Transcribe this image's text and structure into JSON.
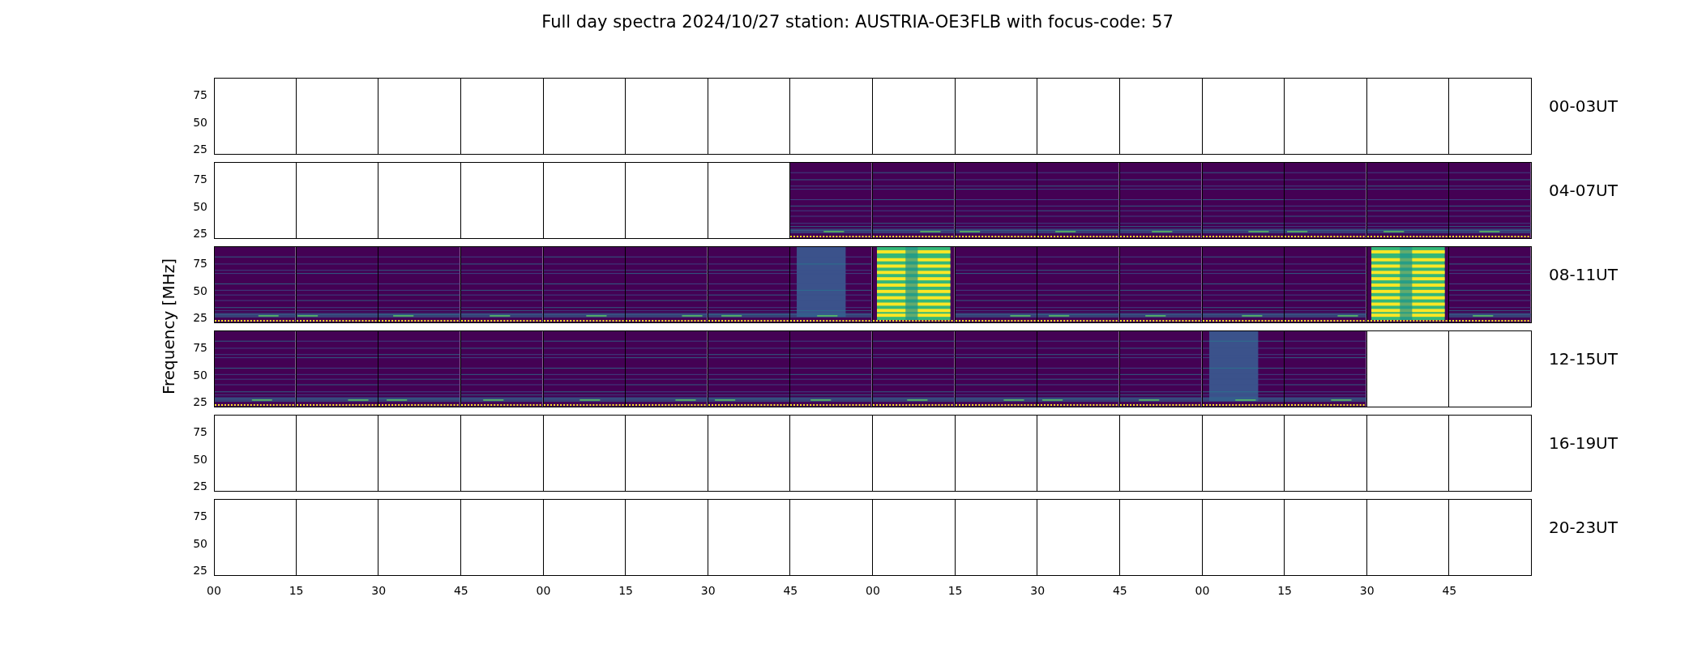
{
  "title": "Full day spectra 2024/10/27 station: AUSTRIA-OE3FLB with focus-code: 57",
  "ylabel": "Frequency [MHz]",
  "xticks": [
    "00",
    "15",
    "30",
    "45",
    "00",
    "15",
    "30",
    "45",
    "00",
    "15",
    "30",
    "45",
    "00",
    "15",
    "30",
    "45"
  ],
  "rows": [
    {
      "label": "00-03UT",
      "yticks": [
        "75",
        "50",
        "25"
      ],
      "panels": [
        {
          "kind": "empty"
        },
        {
          "kind": "empty"
        },
        {
          "kind": "empty"
        },
        {
          "kind": "empty"
        },
        {
          "kind": "empty"
        },
        {
          "kind": "empty"
        },
        {
          "kind": "empty"
        },
        {
          "kind": "empty"
        },
        {
          "kind": "empty"
        },
        {
          "kind": "empty"
        },
        {
          "kind": "empty"
        },
        {
          "kind": "empty"
        },
        {
          "kind": "empty"
        },
        {
          "kind": "empty"
        },
        {
          "kind": "empty"
        },
        {
          "kind": "empty"
        }
      ]
    },
    {
      "label": "04-07UT",
      "yticks": [
        "75",
        "50",
        "25"
      ],
      "panels": [
        {
          "kind": "empty"
        },
        {
          "kind": "empty"
        },
        {
          "kind": "empty"
        },
        {
          "kind": "empty"
        },
        {
          "kind": "empty"
        },
        {
          "kind": "empty"
        },
        {
          "kind": "empty"
        },
        {
          "kind": "spectrum"
        },
        {
          "kind": "spectrum"
        },
        {
          "kind": "spectrum"
        },
        {
          "kind": "spectrum"
        },
        {
          "kind": "spectrum"
        },
        {
          "kind": "spectrum"
        },
        {
          "kind": "spectrum"
        },
        {
          "kind": "spectrum"
        },
        {
          "kind": "spectrum"
        }
      ]
    },
    {
      "label": "08-11UT",
      "yticks": [
        "75",
        "50",
        "25"
      ],
      "panels": [
        {
          "kind": "spectrum"
        },
        {
          "kind": "spectrum"
        },
        {
          "kind": "spectrum"
        },
        {
          "kind": "spectrum"
        },
        {
          "kind": "spectrum"
        },
        {
          "kind": "spectrum"
        },
        {
          "kind": "spectrum"
        },
        {
          "kind": "enhanced"
        },
        {
          "kind": "burst"
        },
        {
          "kind": "spectrum"
        },
        {
          "kind": "spectrum"
        },
        {
          "kind": "spectrum"
        },
        {
          "kind": "spectrum"
        },
        {
          "kind": "spectrum"
        },
        {
          "kind": "burst"
        },
        {
          "kind": "spectrum"
        }
      ]
    },
    {
      "label": "12-15UT",
      "yticks": [
        "75",
        "50",
        "25"
      ],
      "panels": [
        {
          "kind": "spectrum"
        },
        {
          "kind": "spectrum"
        },
        {
          "kind": "spectrum"
        },
        {
          "kind": "spectrum"
        },
        {
          "kind": "spectrum"
        },
        {
          "kind": "spectrum"
        },
        {
          "kind": "spectrum"
        },
        {
          "kind": "spectrum"
        },
        {
          "kind": "spectrum"
        },
        {
          "kind": "spectrum"
        },
        {
          "kind": "spectrum"
        },
        {
          "kind": "spectrum"
        },
        {
          "kind": "enhanced"
        },
        {
          "kind": "spectrum"
        },
        {
          "kind": "empty"
        },
        {
          "kind": "empty"
        }
      ]
    },
    {
      "label": "16-19UT",
      "yticks": [
        "75",
        "50",
        "25"
      ],
      "panels": [
        {
          "kind": "empty"
        },
        {
          "kind": "empty"
        },
        {
          "kind": "empty"
        },
        {
          "kind": "empty"
        },
        {
          "kind": "empty"
        },
        {
          "kind": "empty"
        },
        {
          "kind": "empty"
        },
        {
          "kind": "empty"
        },
        {
          "kind": "empty"
        },
        {
          "kind": "empty"
        },
        {
          "kind": "empty"
        },
        {
          "kind": "empty"
        },
        {
          "kind": "empty"
        },
        {
          "kind": "empty"
        },
        {
          "kind": "empty"
        },
        {
          "kind": "empty"
        }
      ]
    },
    {
      "label": "20-23UT",
      "yticks": [
        "75",
        "50",
        "25"
      ],
      "panels": [
        {
          "kind": "empty"
        },
        {
          "kind": "empty"
        },
        {
          "kind": "empty"
        },
        {
          "kind": "empty"
        },
        {
          "kind": "empty"
        },
        {
          "kind": "empty"
        },
        {
          "kind": "empty"
        },
        {
          "kind": "empty"
        },
        {
          "kind": "empty"
        },
        {
          "kind": "empty"
        },
        {
          "kind": "empty"
        },
        {
          "kind": "empty"
        },
        {
          "kind": "empty"
        },
        {
          "kind": "empty"
        },
        {
          "kind": "empty"
        },
        {
          "kind": "empty"
        }
      ]
    }
  ]
}
